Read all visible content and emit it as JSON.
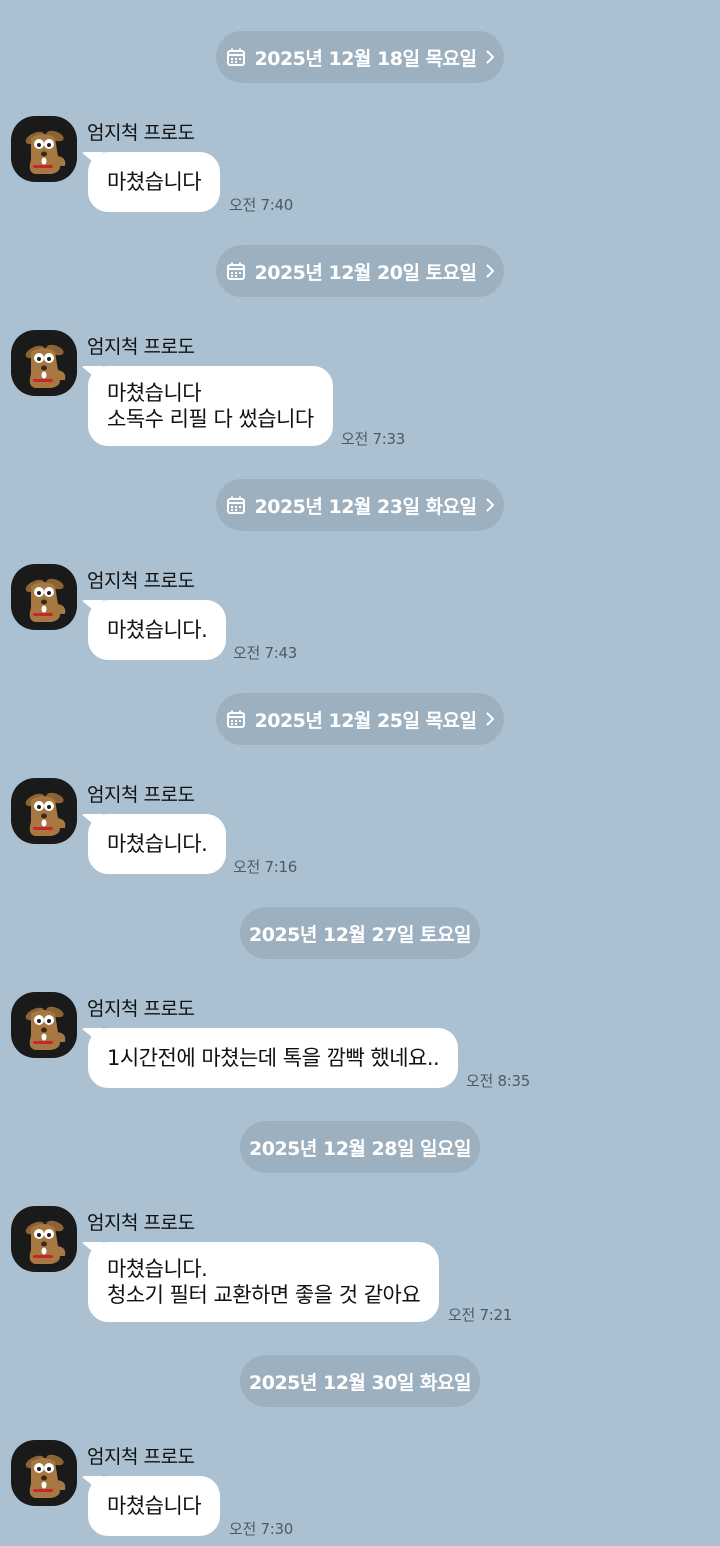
{
  "sender_name": "엄지척 프로도",
  "messages": [
    {
      "date": "2025년 12월 18일 목요일",
      "date_has_icon": true,
      "lines": [
        "마쳤습니다"
      ],
      "time": "오전 7:40"
    },
    {
      "date": "2025년 12월 20일 토요일",
      "date_has_icon": true,
      "lines": [
        "마쳤습니다",
        "소독수 리필 다 썼습니다"
      ],
      "time": "오전 7:33"
    },
    {
      "date": "2025년 12월 23일 화요일",
      "date_has_icon": true,
      "lines": [
        "마쳤습니다."
      ],
      "time": "오전 7:43"
    },
    {
      "date": "2025년 12월 25일 목요일",
      "date_has_icon": true,
      "lines": [
        "마쳤습니다."
      ],
      "time": "오전 7:16"
    },
    {
      "date": "2025년 12월 27일 토요일",
      "date_has_icon": false,
      "lines": [
        "1시간전에 마쳤는데 톡을 깜빡 했네요.."
      ],
      "time": "오전 8:35"
    },
    {
      "date": "2025년 12월 28일 일요일",
      "date_has_icon": false,
      "lines": [
        "마쳤습니다.",
        "청소기 필터 교환하면 좋을 것 같아요"
      ],
      "time": "오전 7:21"
    },
    {
      "date": "2025년 12월 30일 화요일",
      "date_has_icon": false,
      "lines": [
        "마쳤습니다"
      ],
      "time": "오전 7:30"
    }
  ],
  "icons": {
    "date_icon": "calendar-icon",
    "date_arrow": "chevron-right-icon",
    "avatar": "dog-character-avatar"
  },
  "colors": {
    "background": "#abc1d1",
    "date_pill": "#9db0c0",
    "bubble": "#ffffff"
  }
}
